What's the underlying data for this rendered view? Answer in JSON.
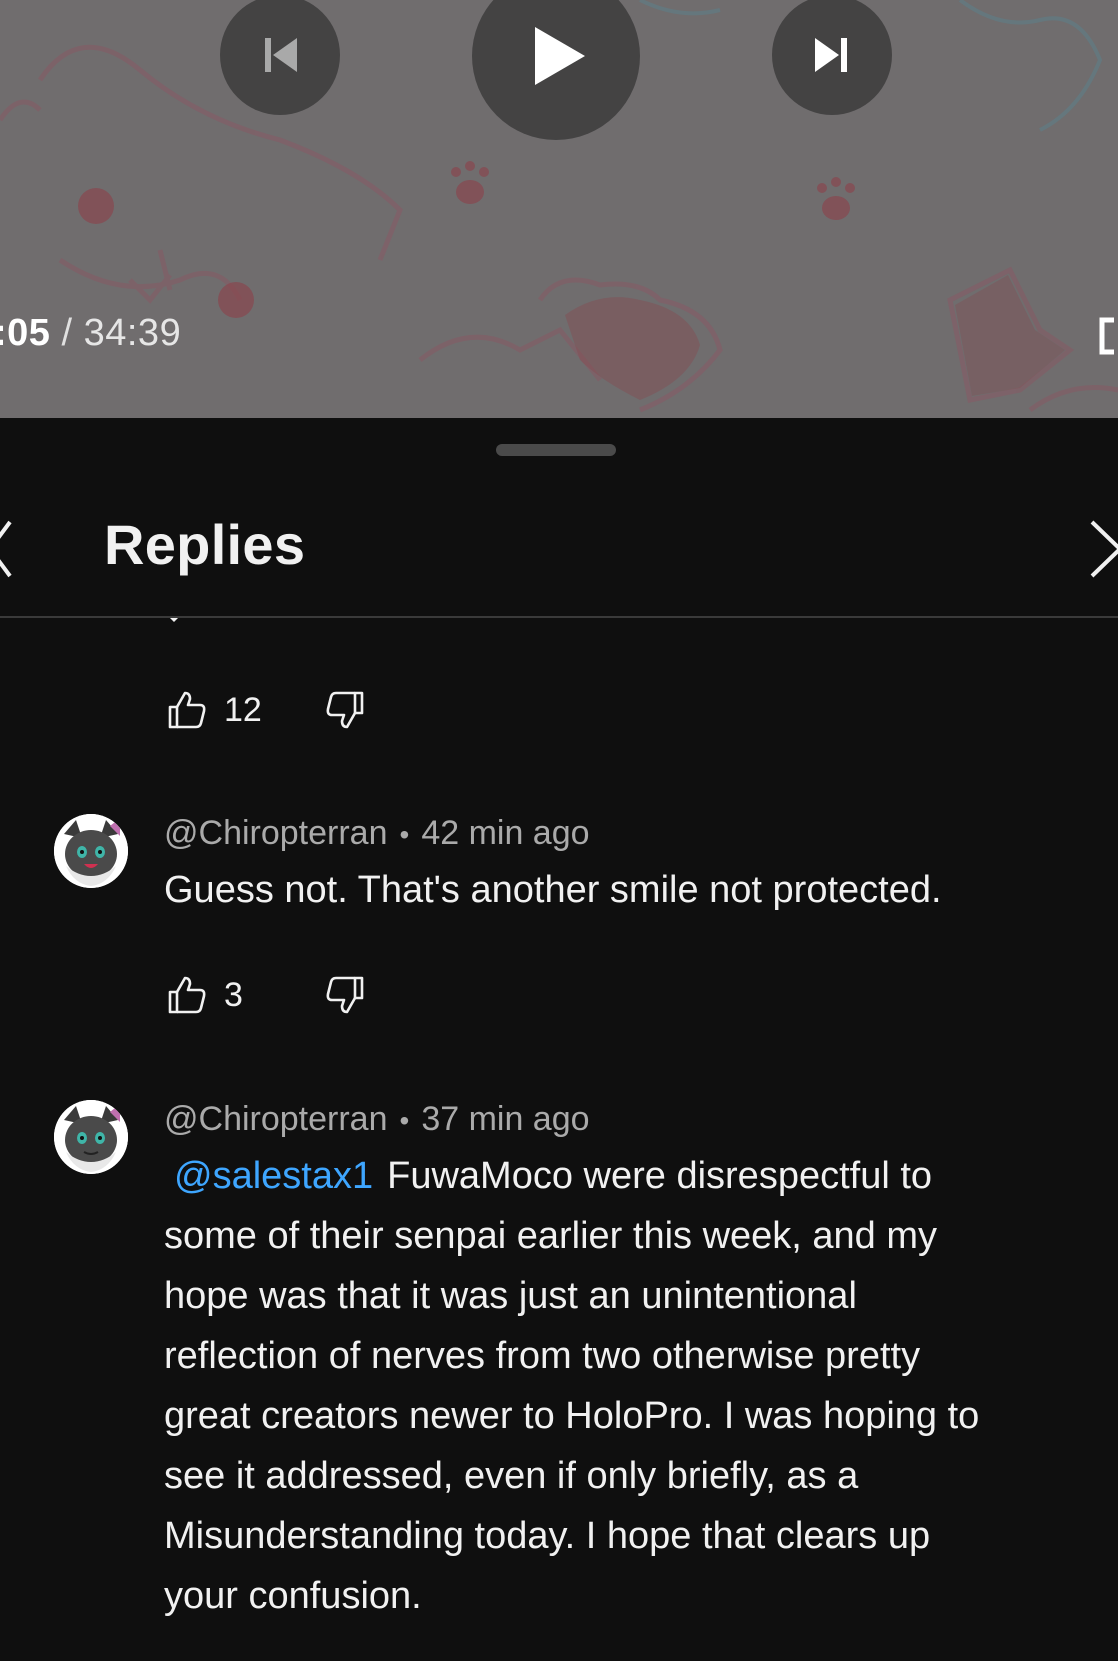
{
  "player": {
    "current_time": ":05",
    "separator": "/",
    "duration": "34:39",
    "icons": {
      "previous": "skip-previous-icon",
      "play": "play-icon",
      "next": "skip-next-icon",
      "fullscreen": "fullscreen-icon"
    }
  },
  "panel": {
    "title": "Replies",
    "icons": {
      "back": "chevron-left-icon",
      "close": "close-icon"
    }
  },
  "comments": [
    {
      "author": "",
      "time": "",
      "text": "",
      "likes": "12"
    },
    {
      "author": "@Chiropterran",
      "dot": "•",
      "time": "42 min ago",
      "text": "Guess not.  That's another smile not protected.",
      "likes": "3"
    },
    {
      "author": "@Chiropterran",
      "dot": "•",
      "time": "37 min ago",
      "mention": "@salestax1",
      "text_lines": [
        "FuwaMoco were disrespectful to",
        "some of their senpai earlier this week, and my",
        "hope was that it was just an unintentional",
        "reflection of nerves from two otherwise pretty",
        "great creators newer to HoloPro.  I was hoping to",
        "see it addressed, even if only briefly, as a",
        "Misunderstanding today.  I hope that clears up",
        "your confusion."
      ]
    }
  ],
  "colors": {
    "background": "#0f0f0f",
    "text": "#f1f1f1",
    "meta": "#aaaaaa",
    "mention": "#3ea6ff"
  }
}
